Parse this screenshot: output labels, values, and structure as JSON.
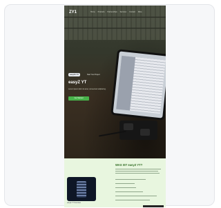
{
  "site": {
    "logo": "ZY1",
    "nav": [
      "Home",
      "Products",
      "Partnerships",
      "Services",
      "Contact",
      "More"
    ],
    "hero": {
      "badge": "easyZ1 YT",
      "badge_text": "Start Your Project",
      "title": "easyZ YT",
      "subtitle": "Lorem ipsum dolor sit amet, consectetur adipiscing.",
      "button": "Get Started"
    },
    "about": {
      "title": "WAS IST easyZ YT?",
      "caption": "easyZ YT Overview"
    }
  }
}
